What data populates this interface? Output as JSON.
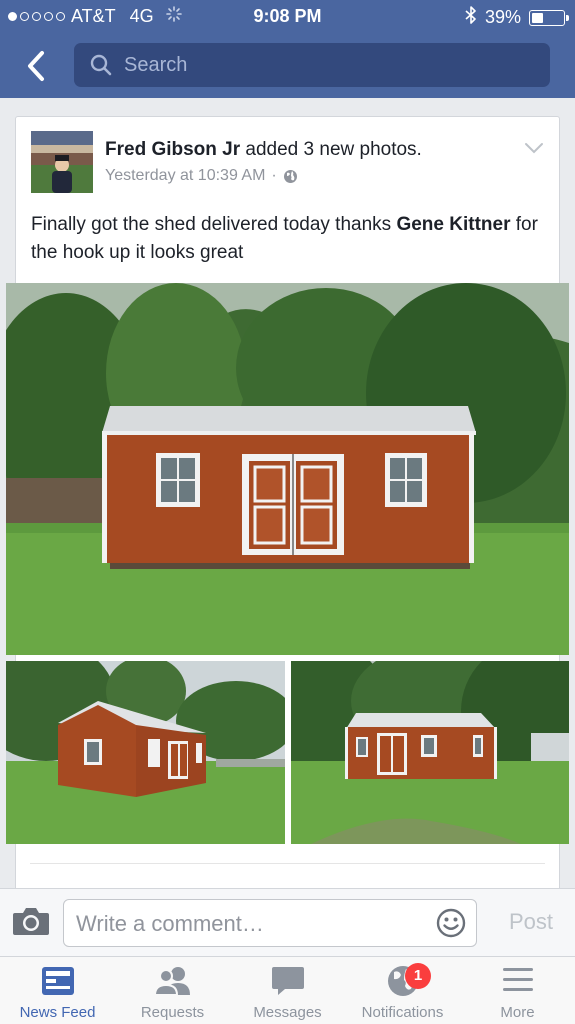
{
  "status_bar": {
    "carrier": "AT&T",
    "network": "4G",
    "time": "9:08 PM",
    "battery": "39%",
    "battery_level": 0.39,
    "signal_bars_filled": 1,
    "signal_bars_total": 5
  },
  "nav": {
    "back_icon": "chevron-left-icon",
    "search_placeholder": "Search"
  },
  "post": {
    "author": "Fred Gibson Jr",
    "action": " added 3 new photos.",
    "timestamp": "Yesterday at 10:39 AM",
    "separator": "·",
    "privacy_icon": "globe-icon",
    "text_before": "Finally got the shed delivered today thanks ",
    "mention": "Gene Kittner",
    "text_after": " for the hook up it looks great",
    "photo_count": 3
  },
  "comment_bar": {
    "placeholder": "Write a comment…",
    "post_label": "Post"
  },
  "tabs": [
    {
      "label": "News Feed",
      "icon": "news-feed-icon",
      "active": true
    },
    {
      "label": "Requests",
      "icon": "friends-icon",
      "active": false
    },
    {
      "label": "Messages",
      "icon": "chat-bubble-icon",
      "active": false
    },
    {
      "label": "Notifications",
      "icon": "globe-icon",
      "active": false,
      "badge": "1"
    },
    {
      "label": "More",
      "icon": "menu-icon",
      "active": false
    }
  ],
  "colors": {
    "brand": "#4a66a0",
    "active_tab": "#4267b2",
    "badge": "#fa3e3e"
  }
}
